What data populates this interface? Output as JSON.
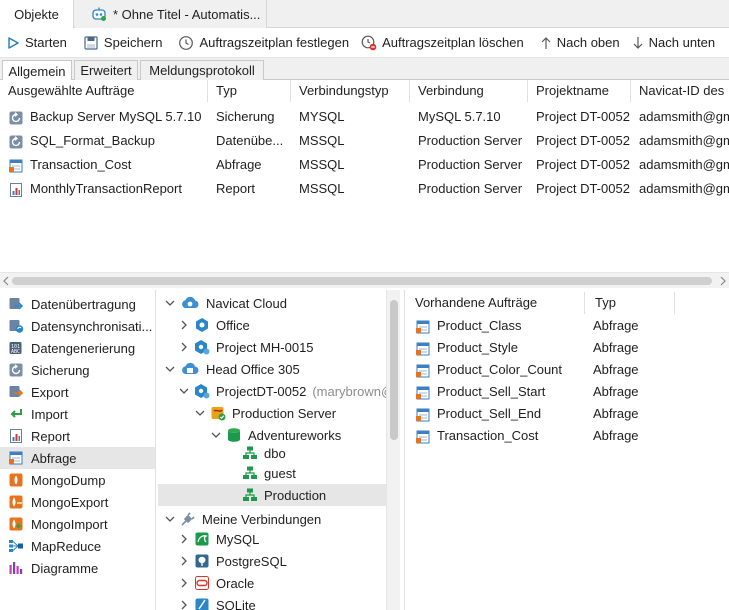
{
  "tabs": {
    "objects": "Objekte",
    "query": "* Ohne Titel - Automatis..."
  },
  "toolbar": {
    "start": "Starten",
    "save": "Speichern",
    "set_schedule": "Auftragszeitplan festlegen",
    "delete_schedule": "Auftragszeitplan löschen",
    "move_up": "Nach oben",
    "move_down": "Nach unten"
  },
  "subtabs": [
    "Allgemein",
    "Erweitert",
    "Meldungsprotokoll"
  ],
  "job_table": {
    "columns": [
      "Ausgewählte Aufträge",
      "Typ",
      "Verbindungstyp",
      "Verbindung",
      "Projektname",
      "Navicat-ID des"
    ],
    "rows": [
      {
        "icon": "backup-icon",
        "name": "Backup Server MySQL 5.7.10",
        "type": "Sicherung",
        "conn_type": "MYSQL",
        "connection": "MySQL 5.7.10",
        "project": "Project DT-0052",
        "navicat_id": "adamsmith@gm"
      },
      {
        "icon": "backup-icon",
        "name": "SQL_Format_Backup",
        "type": "Datenübe...",
        "conn_type": "MSSQL",
        "connection": "Production Server",
        "project": "Project DT-0052",
        "navicat_id": "adamsmith@gm"
      },
      {
        "icon": "query-icon",
        "name": "Transaction_Cost",
        "type": "Abfrage",
        "conn_type": "MSSQL",
        "connection": "Production Server",
        "project": "Project DT-0052",
        "navicat_id": "adamsmith@gm"
      },
      {
        "icon": "report-icon",
        "name": "MonthlyTransactionReport",
        "type": "Report",
        "conn_type": "MSSQL",
        "connection": "Production Server",
        "project": "Project DT-0052",
        "navicat_id": "adamsmith@gm"
      }
    ]
  },
  "left_nav": {
    "items": [
      {
        "label": "Datenübertragung",
        "icon": "data-transfer-icon"
      },
      {
        "label": "Datensynchronisati...",
        "icon": "data-sync-icon"
      },
      {
        "label": "Datengenerierung",
        "icon": "data-generation-icon"
      },
      {
        "label": "Sicherung",
        "icon": "backup-icon"
      },
      {
        "label": "Export",
        "icon": "export-icon"
      },
      {
        "label": "Import",
        "icon": "import-icon"
      },
      {
        "label": "Report",
        "icon": "report-icon"
      },
      {
        "label": "Abfrage",
        "icon": "query-icon"
      },
      {
        "label": "MongoDump",
        "icon": "mongodump-icon"
      },
      {
        "label": "MongoExport",
        "icon": "mongoexport-icon"
      },
      {
        "label": "MongoImport",
        "icon": "mongoimport-icon"
      },
      {
        "label": "MapReduce",
        "icon": "mapreduce-icon"
      },
      {
        "label": "Diagramme",
        "icon": "chart-icon"
      }
    ],
    "selected": "Abfrage"
  },
  "tree": {
    "navicat_cloud": "Navicat Cloud",
    "office": "Office",
    "project_mh": "Project MH-0015",
    "head_office": "Head Office 305",
    "project_dt": "ProjectDT-0052",
    "project_dt_owner": "(marybrown@",
    "production_server": "Production Server",
    "adventureworks": "Adventureworks",
    "dbo": "dbo",
    "guest": "guest",
    "production": "Production",
    "my_connections": "Meine Verbindungen",
    "mysql": "MySQL",
    "postgresql": "PostgreSQL",
    "oracle": "Oracle",
    "sqlite": "SQLite"
  },
  "available_jobs": {
    "columns": [
      "Vorhandene Aufträge",
      "Typ"
    ],
    "rows": [
      {
        "name": "Product_Class",
        "type": "Abfrage"
      },
      {
        "name": "Product_Style",
        "type": "Abfrage"
      },
      {
        "name": "Product_Color_Count",
        "type": "Abfrage"
      },
      {
        "name": "Product_Sell_Start",
        "type": "Abfrage"
      },
      {
        "name": "Product_Sell_End",
        "type": "Abfrage"
      },
      {
        "name": "Transaction_Cost",
        "type": "Abfrage"
      }
    ]
  },
  "colors": {
    "accent": "#1e7bc4",
    "selection": "#e6e6e6",
    "query_orange": "#e8731e",
    "server_green": "#1a9a4a"
  }
}
